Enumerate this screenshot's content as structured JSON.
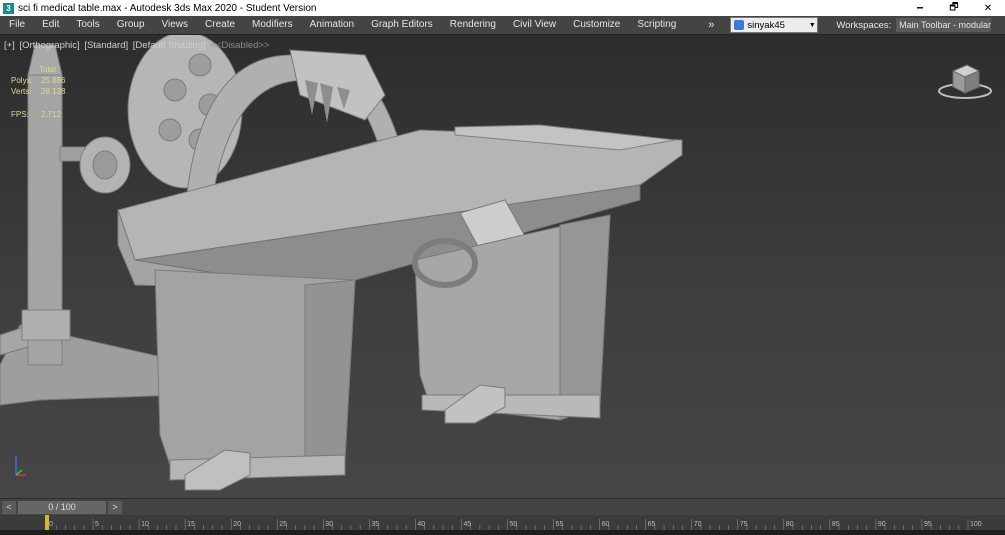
{
  "window": {
    "title": "sci fi medical table.max - Autodesk 3ds Max 2020 - Student Version",
    "icon": "3ds-max-app-icon",
    "minimize": "🗕",
    "restore": "🗗",
    "close": "✕"
  },
  "menu": {
    "items": [
      "File",
      "Edit",
      "Tools",
      "Group",
      "Views",
      "Create",
      "Modifiers",
      "Animation",
      "Graph Editors",
      "Rendering",
      "Civil View",
      "Customize",
      "Scripting"
    ],
    "more": "»",
    "user": "sinyak45",
    "user_caret": "▼",
    "workspaces_label": "Workspaces:",
    "workspace": "Main Toolbar - modular"
  },
  "viewport": {
    "labels": [
      "[+]",
      "[Orthographic]",
      "[Standard]",
      "[Default Shading]"
    ],
    "disabled": "<<Disabled>>",
    "stats": {
      "total": "Total",
      "polys_label": "Polys:",
      "polys": "25 886",
      "verts_label": "Verts:",
      "verts": "28 128",
      "fps_label": "FPS:",
      "fps": "2,712"
    },
    "viewcube_icon": "viewcube-icon",
    "axis_icon": "axis-tripod-icon"
  },
  "timeline": {
    "prev": "<",
    "slider": "0 / 100",
    "next": ">",
    "ticks": [
      "0",
      "5",
      "10",
      "15",
      "20",
      "25",
      "30",
      "35",
      "40",
      "45",
      "50",
      "55",
      "60",
      "65",
      "70",
      "75",
      "80",
      "85",
      "90",
      "95",
      "100"
    ]
  },
  "colors": {
    "viewport_bg": "#3c3c3c",
    "menu_bg": "#444444",
    "stats_text": "#e0d890",
    "model_gray": "#a9a9a9"
  }
}
